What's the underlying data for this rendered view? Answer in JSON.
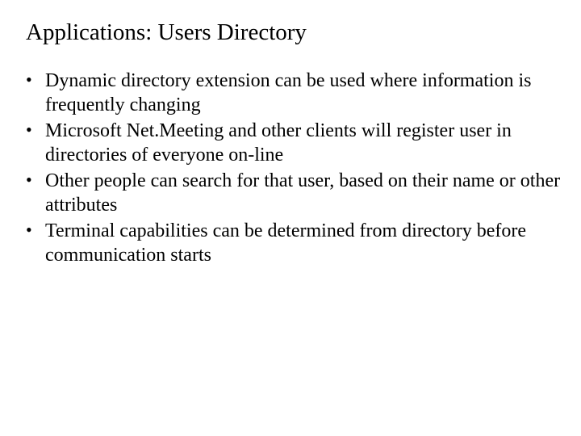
{
  "slide": {
    "title": "Applications: Users Directory",
    "bullets": [
      "Dynamic directory extension can be used where information is frequently changing",
      "Microsoft Net.Meeting and other clients will register user in directories of everyone on-line",
      "Other people can search for that user, based on their name or other attributes",
      "Terminal capabilities can be determined from directory before communication starts"
    ]
  }
}
